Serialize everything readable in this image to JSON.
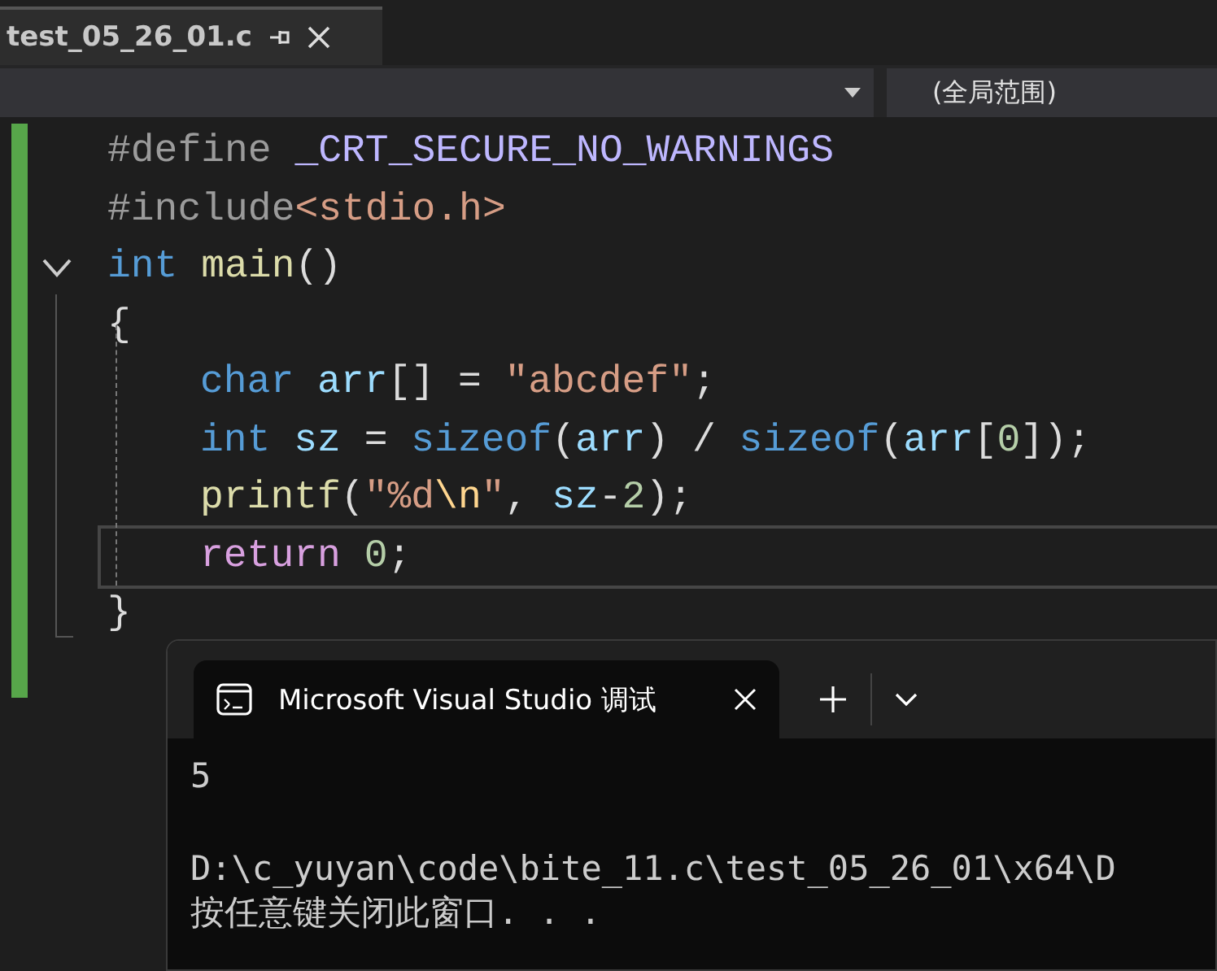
{
  "file_tab": {
    "title": "test_05_26_01.c",
    "selected": true
  },
  "navigation_bar": {
    "scope": "(全局范围)"
  },
  "code_lines": [
    {
      "foldable": false,
      "current": false,
      "indented": false,
      "tokens": [
        {
          "kind": "preproc",
          "text": "#define "
        },
        {
          "kind": "macro",
          "text": "_CRT_SECURE_NO_WARNINGS"
        }
      ]
    },
    {
      "foldable": false,
      "current": false,
      "indented": false,
      "tokens": [
        {
          "kind": "preproc",
          "text": "#include"
        },
        {
          "kind": "string",
          "text": "<stdio.h>"
        }
      ]
    },
    {
      "foldable": true,
      "current": false,
      "indented": false,
      "tokens": [
        {
          "kind": "keyword",
          "text": "int "
        },
        {
          "kind": "function",
          "text": "main"
        },
        {
          "kind": "plain",
          "text": "()"
        }
      ]
    },
    {
      "foldable": false,
      "current": false,
      "indented": false,
      "tokens": [
        {
          "kind": "plain",
          "text": "{"
        }
      ]
    },
    {
      "foldable": false,
      "current": false,
      "indented": true,
      "tokens": [
        {
          "kind": "keyword",
          "text": "char "
        },
        {
          "kind": "variable",
          "text": "arr"
        },
        {
          "kind": "plain",
          "text": "[] = "
        },
        {
          "kind": "string",
          "text": "\"abcdef\""
        },
        {
          "kind": "plain",
          "text": ";"
        }
      ]
    },
    {
      "foldable": false,
      "current": false,
      "indented": true,
      "tokens": [
        {
          "kind": "keyword",
          "text": "int "
        },
        {
          "kind": "variable",
          "text": "sz"
        },
        {
          "kind": "plain",
          "text": " = "
        },
        {
          "kind": "keyword",
          "text": "sizeof"
        },
        {
          "kind": "plain",
          "text": "("
        },
        {
          "kind": "variable",
          "text": "arr"
        },
        {
          "kind": "plain",
          "text": ") / "
        },
        {
          "kind": "keyword",
          "text": "sizeof"
        },
        {
          "kind": "plain",
          "text": "("
        },
        {
          "kind": "variable",
          "text": "arr"
        },
        {
          "kind": "plain",
          "text": "["
        },
        {
          "kind": "number",
          "text": "0"
        },
        {
          "kind": "plain",
          "text": "]);"
        }
      ]
    },
    {
      "foldable": false,
      "current": false,
      "indented": true,
      "tokens": [
        {
          "kind": "function",
          "text": "printf"
        },
        {
          "kind": "plain",
          "text": "("
        },
        {
          "kind": "string",
          "text": "\"%d"
        },
        {
          "kind": "escape",
          "text": "\\n"
        },
        {
          "kind": "string",
          "text": "\""
        },
        {
          "kind": "plain",
          "text": ", "
        },
        {
          "kind": "variable",
          "text": "sz"
        },
        {
          "kind": "plain",
          "text": "-"
        },
        {
          "kind": "number",
          "text": "2"
        },
        {
          "kind": "plain",
          "text": ");"
        }
      ]
    },
    {
      "foldable": false,
      "current": true,
      "indented": true,
      "tokens": [
        {
          "kind": "control",
          "text": "return "
        },
        {
          "kind": "number",
          "text": "0"
        },
        {
          "kind": "plain",
          "text": ";"
        }
      ]
    },
    {
      "foldable": false,
      "current": false,
      "indented": false,
      "tokens": [
        {
          "kind": "plain",
          "text": "}"
        }
      ]
    }
  ],
  "terminal": {
    "tab_title": "Microsoft Visual Studio 调试",
    "output": [
      {
        "text": "5",
        "gap_before": false
      },
      {
        "text": "D:\\c_yuyan\\code\\bite_11.c\\test_05_26_01\\x64\\D",
        "gap_before": true
      },
      {
        "text": "按任意键关闭此窗口. . .",
        "gap_before": false
      }
    ]
  }
}
